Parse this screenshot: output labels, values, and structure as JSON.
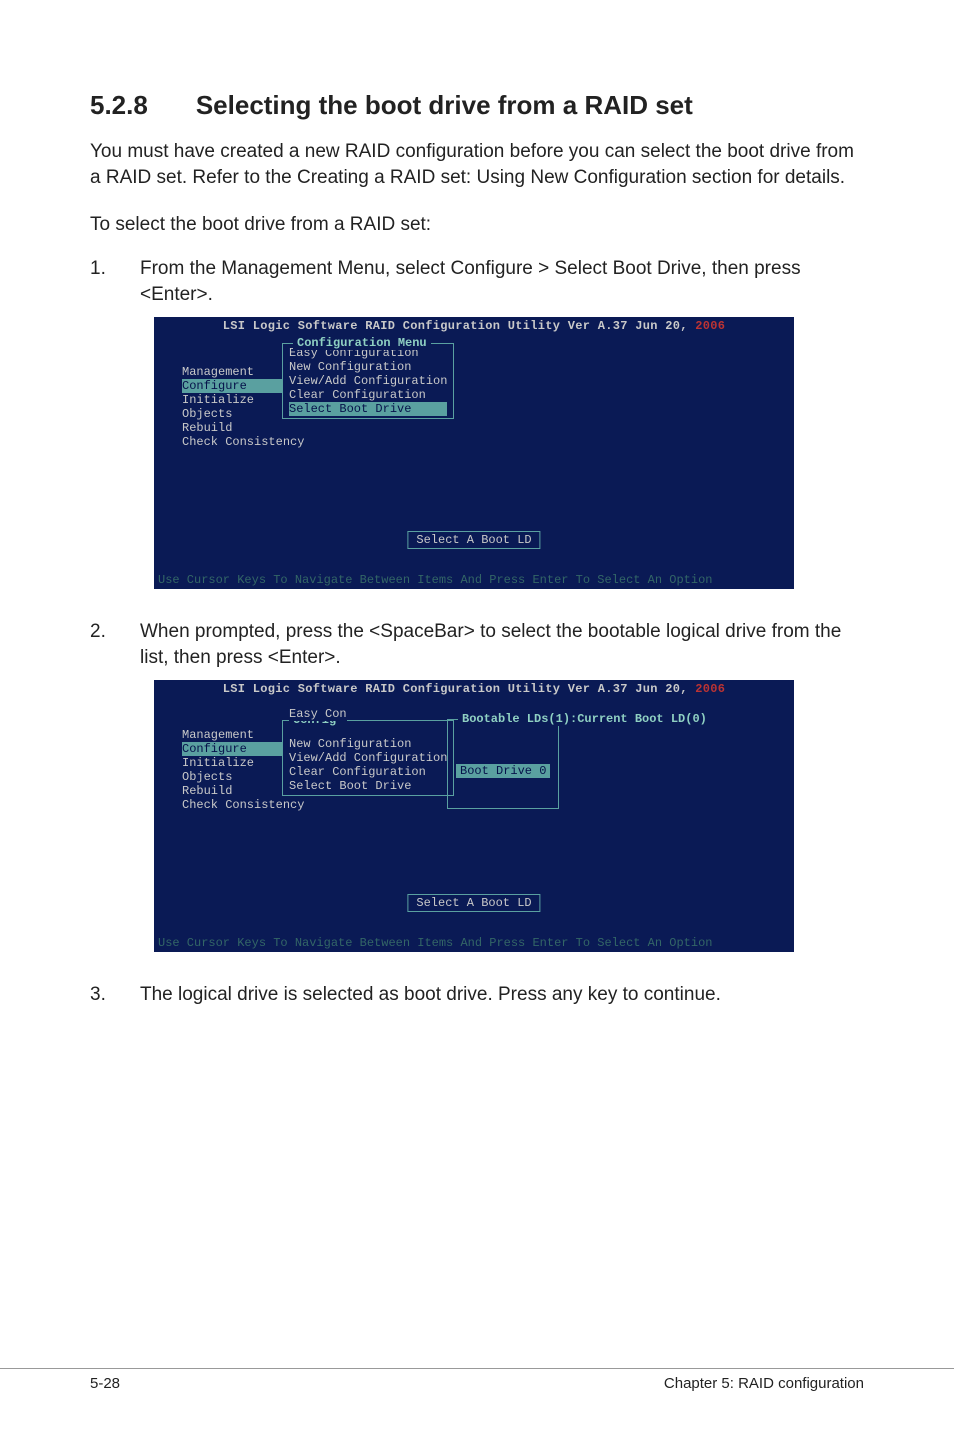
{
  "section": {
    "number": "5.2.8",
    "title": "Selecting the boot drive from a RAID set"
  },
  "intro": "You must have created a new RAID configuration before you can select the boot drive from a RAID set. Refer to the Creating a RAID set: Using New Configuration section for details.",
  "lead": "To select the boot drive from a RAID set:",
  "steps": {
    "s1": {
      "num": "1.",
      "text": "From the Management Menu, select Configure > Select Boot Drive, then press <Enter>."
    },
    "s2": {
      "num": "2.",
      "text": "When prompted, press the <SpaceBar> to select the bootable logical drive from the list, then press <Enter>."
    },
    "s3": {
      "num": "3.",
      "text": "The logical drive is selected as boot drive. Press any key to continue."
    }
  },
  "bios": {
    "title_main": "LSI Logic Software RAID Configuration Utility Ver A.37 Jun 20,",
    "title_year": " 2006",
    "mgmt_menu": {
      "label": "Management",
      "items": [
        "Configure",
        "Initialize",
        "Objects",
        "Rebuild",
        "Check Consistency"
      ],
      "selected": "Configure"
    },
    "config_menu": {
      "title": "Configuration Menu",
      "items": [
        "Easy Configuration",
        "New Configuration",
        "View/Add Configuration",
        "Clear Configuration",
        "Select Boot Drive"
      ],
      "selected": "Select Boot Drive"
    },
    "config_menu2": {
      "title_prefix": "Config",
      "easy_prefix": "Easy Con",
      "boot_panel_title": "Bootable LDs(1):Current Boot LD(0)",
      "boot_panel_item": "Boot Drive 0"
    },
    "status_text": "Select A Boot LD",
    "help_text": "Use Cursor Keys To Navigate Between Items And Press Enter To Select An Option"
  },
  "footer": {
    "page": "5-28",
    "chapter": "Chapter 5: RAID configuration"
  }
}
